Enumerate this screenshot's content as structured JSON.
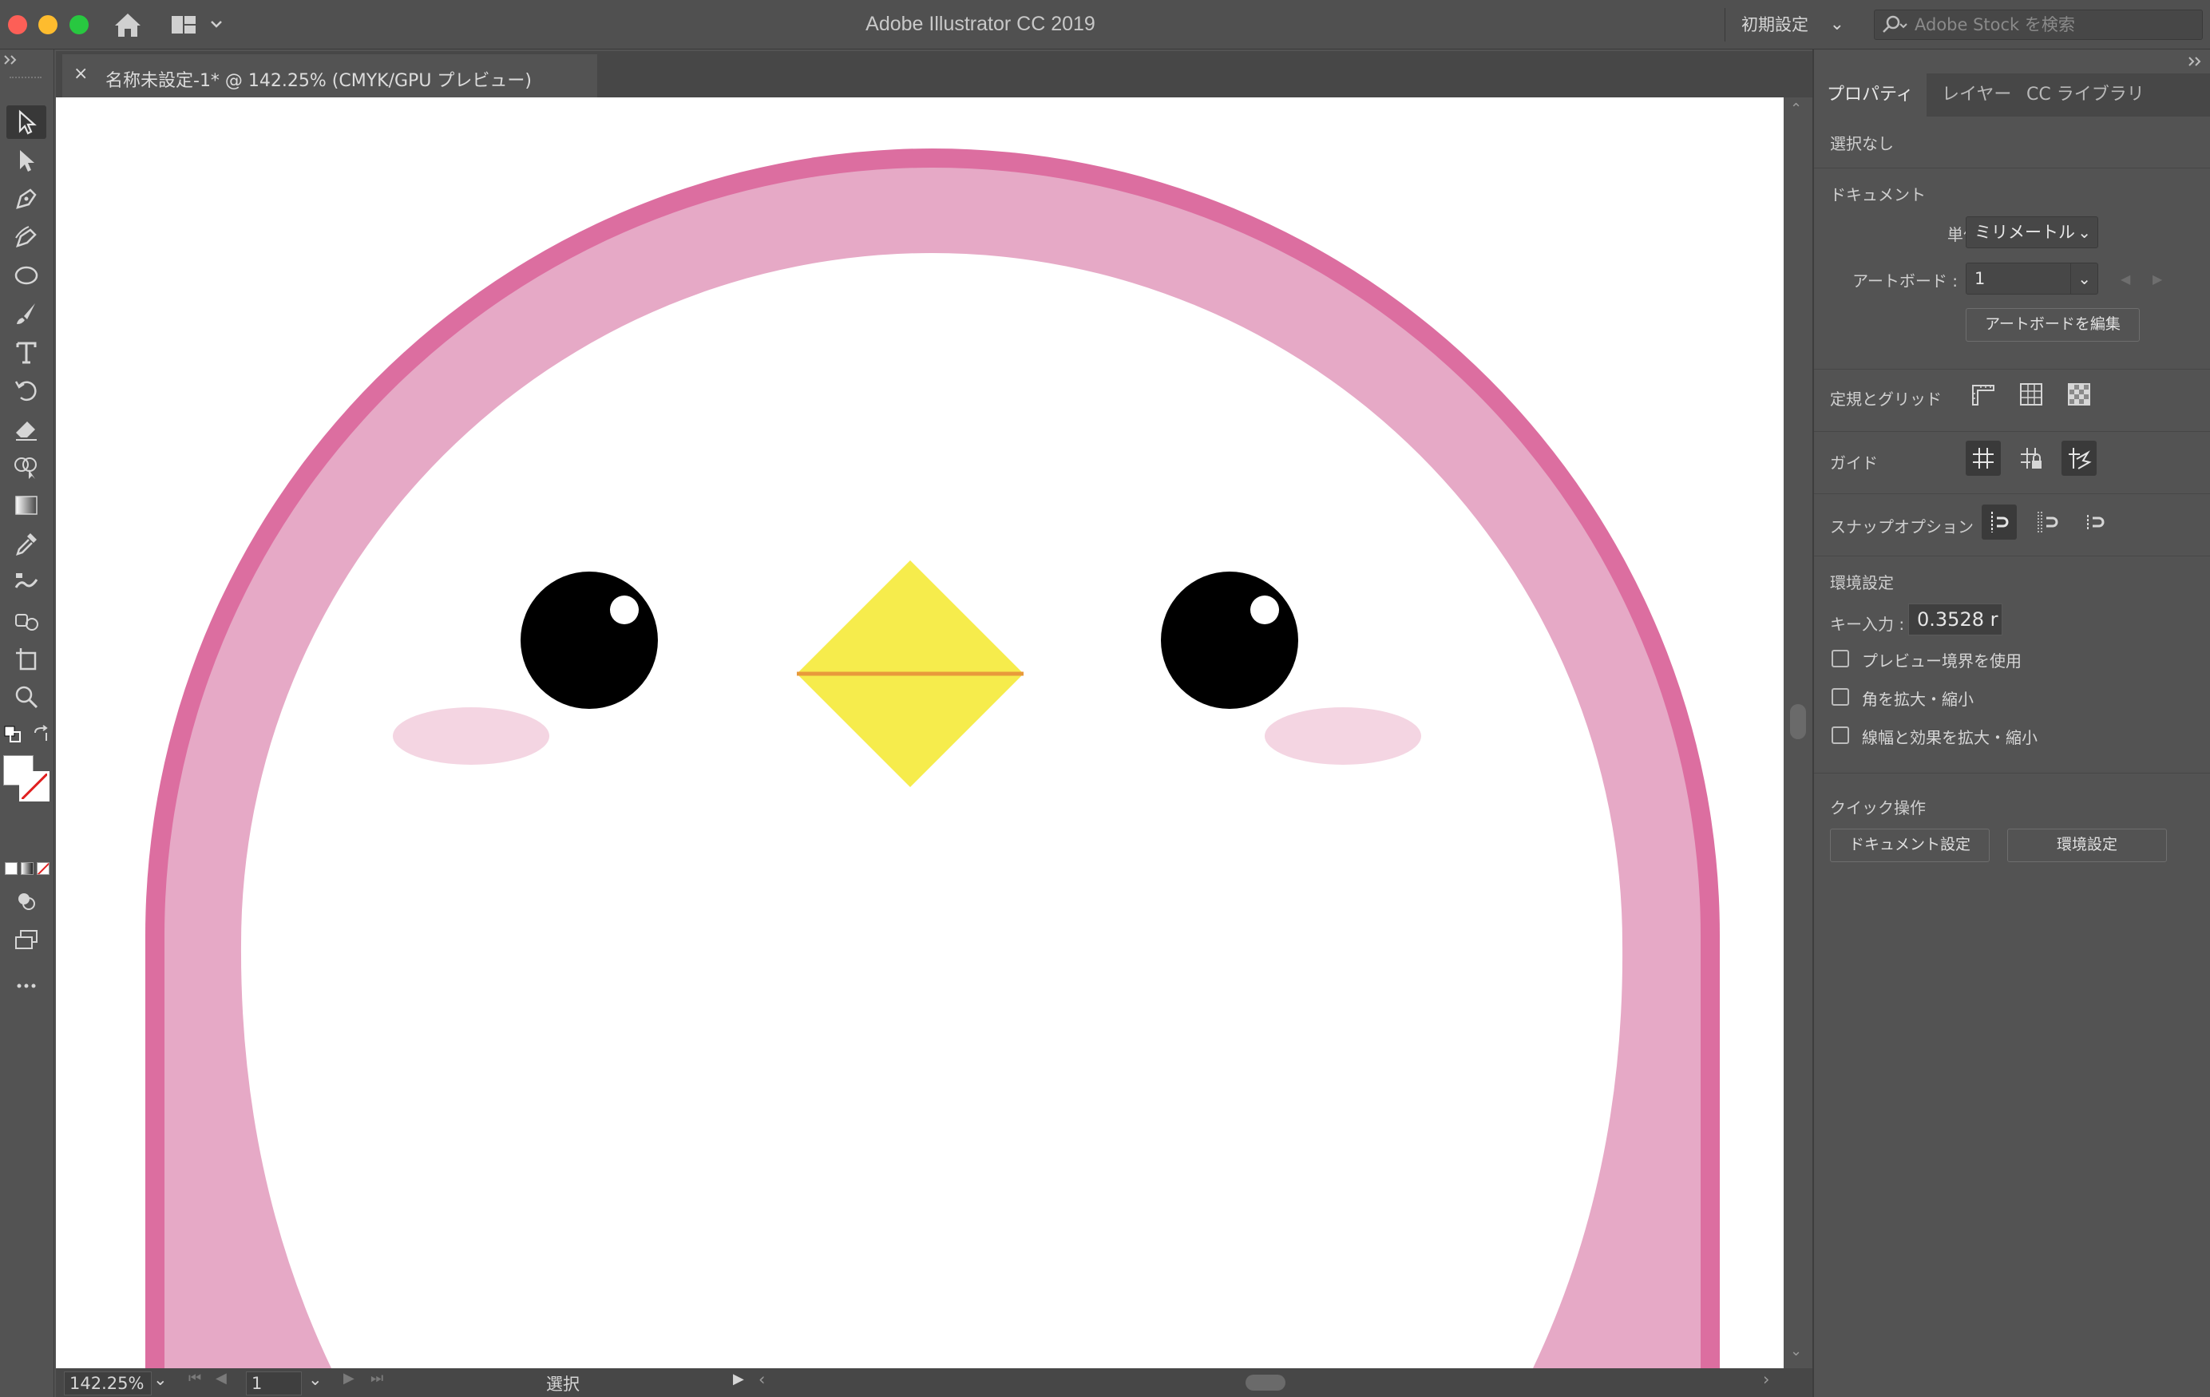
{
  "app": {
    "title": "Adobe Illustrator CC 2019",
    "workspace": "初期設定",
    "stock_search_placeholder": "Adobe Stock を検索"
  },
  "document": {
    "tab_label": "名称未設定-1* @ 142.25% (CMYK/GPU プレビュー)",
    "close_glyph": "×"
  },
  "status": {
    "zoom": "142.25%",
    "artboard": "1",
    "tool_status": "選択"
  },
  "panel": {
    "tabs": [
      "プロパティ",
      "レイヤー",
      "CC ライブラリ"
    ],
    "active_tab": "プロパティ",
    "selection": "選択なし",
    "document_section": "ドキュメント",
    "unit_label": "単位 :",
    "unit_value": "ミリメートル",
    "artboard_label": "アートボード :",
    "artboard_value": "1",
    "edit_artboard_button": "アートボードを編集",
    "rulers_grid_label": "定規とグリッド",
    "guides_label": "ガイド",
    "snap_label": "スナップオプション",
    "preferences_section": "環境設定",
    "key_input_label": "キー入力 :",
    "key_input_value": "0.3528 r",
    "checkboxes": [
      "プレビュー境界を使用",
      "角を拡大・縮小",
      "線幅と効果を拡大・縮小"
    ],
    "quick_actions_section": "クイック操作",
    "doc_settings_button": "ドキュメント設定",
    "preferences_button": "環境設定"
  },
  "artwork_colors": {
    "outline": "#dc6ea0",
    "band": "#e6a9c6",
    "cheek": "#f4d5e2",
    "beak": "#f6ec4c",
    "beak_line": "#e89a3b",
    "eye": "#000000"
  }
}
